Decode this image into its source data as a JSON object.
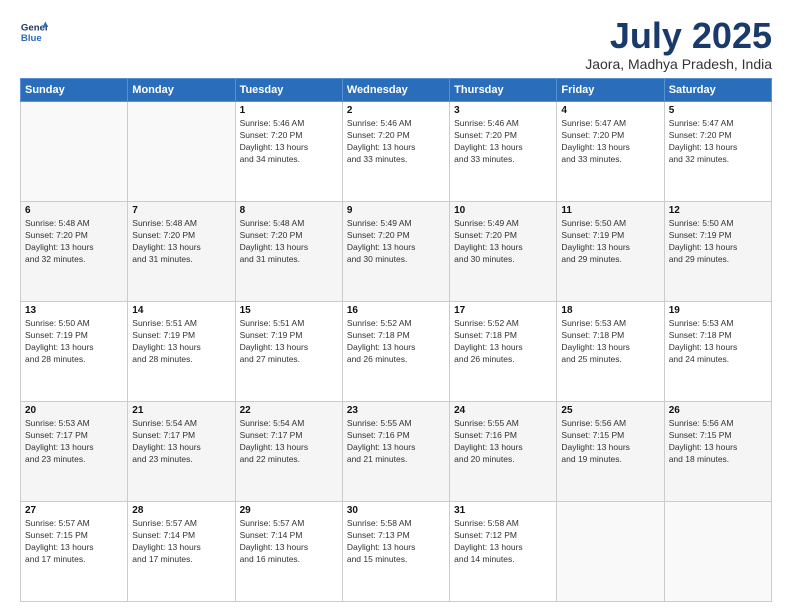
{
  "header": {
    "logo_line1": "General",
    "logo_line2": "Blue",
    "month": "July 2025",
    "location": "Jaora, Madhya Pradesh, India"
  },
  "weekdays": [
    "Sunday",
    "Monday",
    "Tuesday",
    "Wednesday",
    "Thursday",
    "Friday",
    "Saturday"
  ],
  "weeks": [
    [
      {
        "day": "",
        "detail": ""
      },
      {
        "day": "",
        "detail": ""
      },
      {
        "day": "1",
        "detail": "Sunrise: 5:46 AM\nSunset: 7:20 PM\nDaylight: 13 hours\nand 34 minutes."
      },
      {
        "day": "2",
        "detail": "Sunrise: 5:46 AM\nSunset: 7:20 PM\nDaylight: 13 hours\nand 33 minutes."
      },
      {
        "day": "3",
        "detail": "Sunrise: 5:46 AM\nSunset: 7:20 PM\nDaylight: 13 hours\nand 33 minutes."
      },
      {
        "day": "4",
        "detail": "Sunrise: 5:47 AM\nSunset: 7:20 PM\nDaylight: 13 hours\nand 33 minutes."
      },
      {
        "day": "5",
        "detail": "Sunrise: 5:47 AM\nSunset: 7:20 PM\nDaylight: 13 hours\nand 32 minutes."
      }
    ],
    [
      {
        "day": "6",
        "detail": "Sunrise: 5:48 AM\nSunset: 7:20 PM\nDaylight: 13 hours\nand 32 minutes."
      },
      {
        "day": "7",
        "detail": "Sunrise: 5:48 AM\nSunset: 7:20 PM\nDaylight: 13 hours\nand 31 minutes."
      },
      {
        "day": "8",
        "detail": "Sunrise: 5:48 AM\nSunset: 7:20 PM\nDaylight: 13 hours\nand 31 minutes."
      },
      {
        "day": "9",
        "detail": "Sunrise: 5:49 AM\nSunset: 7:20 PM\nDaylight: 13 hours\nand 30 minutes."
      },
      {
        "day": "10",
        "detail": "Sunrise: 5:49 AM\nSunset: 7:20 PM\nDaylight: 13 hours\nand 30 minutes."
      },
      {
        "day": "11",
        "detail": "Sunrise: 5:50 AM\nSunset: 7:19 PM\nDaylight: 13 hours\nand 29 minutes."
      },
      {
        "day": "12",
        "detail": "Sunrise: 5:50 AM\nSunset: 7:19 PM\nDaylight: 13 hours\nand 29 minutes."
      }
    ],
    [
      {
        "day": "13",
        "detail": "Sunrise: 5:50 AM\nSunset: 7:19 PM\nDaylight: 13 hours\nand 28 minutes."
      },
      {
        "day": "14",
        "detail": "Sunrise: 5:51 AM\nSunset: 7:19 PM\nDaylight: 13 hours\nand 28 minutes."
      },
      {
        "day": "15",
        "detail": "Sunrise: 5:51 AM\nSunset: 7:19 PM\nDaylight: 13 hours\nand 27 minutes."
      },
      {
        "day": "16",
        "detail": "Sunrise: 5:52 AM\nSunset: 7:18 PM\nDaylight: 13 hours\nand 26 minutes."
      },
      {
        "day": "17",
        "detail": "Sunrise: 5:52 AM\nSunset: 7:18 PM\nDaylight: 13 hours\nand 26 minutes."
      },
      {
        "day": "18",
        "detail": "Sunrise: 5:53 AM\nSunset: 7:18 PM\nDaylight: 13 hours\nand 25 minutes."
      },
      {
        "day": "19",
        "detail": "Sunrise: 5:53 AM\nSunset: 7:18 PM\nDaylight: 13 hours\nand 24 minutes."
      }
    ],
    [
      {
        "day": "20",
        "detail": "Sunrise: 5:53 AM\nSunset: 7:17 PM\nDaylight: 13 hours\nand 23 minutes."
      },
      {
        "day": "21",
        "detail": "Sunrise: 5:54 AM\nSunset: 7:17 PM\nDaylight: 13 hours\nand 23 minutes."
      },
      {
        "day": "22",
        "detail": "Sunrise: 5:54 AM\nSunset: 7:17 PM\nDaylight: 13 hours\nand 22 minutes."
      },
      {
        "day": "23",
        "detail": "Sunrise: 5:55 AM\nSunset: 7:16 PM\nDaylight: 13 hours\nand 21 minutes."
      },
      {
        "day": "24",
        "detail": "Sunrise: 5:55 AM\nSunset: 7:16 PM\nDaylight: 13 hours\nand 20 minutes."
      },
      {
        "day": "25",
        "detail": "Sunrise: 5:56 AM\nSunset: 7:15 PM\nDaylight: 13 hours\nand 19 minutes."
      },
      {
        "day": "26",
        "detail": "Sunrise: 5:56 AM\nSunset: 7:15 PM\nDaylight: 13 hours\nand 18 minutes."
      }
    ],
    [
      {
        "day": "27",
        "detail": "Sunrise: 5:57 AM\nSunset: 7:15 PM\nDaylight: 13 hours\nand 17 minutes."
      },
      {
        "day": "28",
        "detail": "Sunrise: 5:57 AM\nSunset: 7:14 PM\nDaylight: 13 hours\nand 17 minutes."
      },
      {
        "day": "29",
        "detail": "Sunrise: 5:57 AM\nSunset: 7:14 PM\nDaylight: 13 hours\nand 16 minutes."
      },
      {
        "day": "30",
        "detail": "Sunrise: 5:58 AM\nSunset: 7:13 PM\nDaylight: 13 hours\nand 15 minutes."
      },
      {
        "day": "31",
        "detail": "Sunrise: 5:58 AM\nSunset: 7:12 PM\nDaylight: 13 hours\nand 14 minutes."
      },
      {
        "day": "",
        "detail": ""
      },
      {
        "day": "",
        "detail": ""
      }
    ]
  ]
}
